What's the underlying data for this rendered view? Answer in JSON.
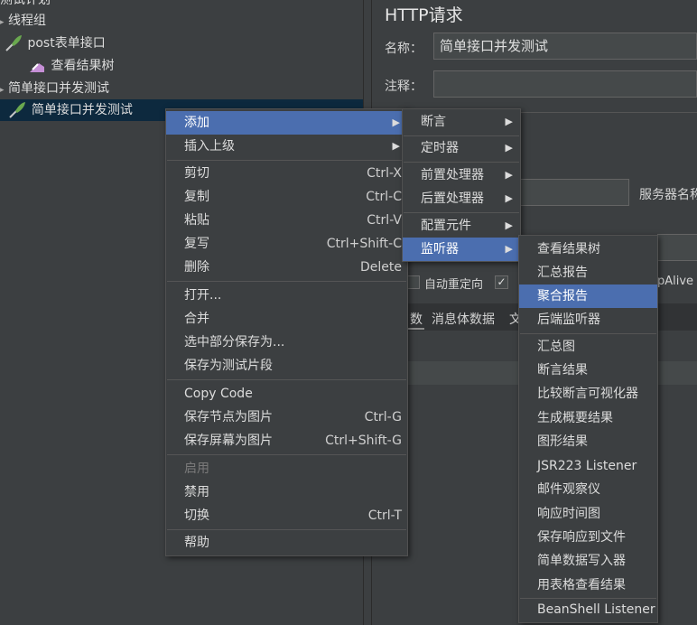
{
  "tree": {
    "items": [
      {
        "label": "测试计划"
      },
      {
        "label": "线程组"
      },
      {
        "label": "post表单接口"
      },
      {
        "label": "查看结果树"
      },
      {
        "label": "简单接口并发测试"
      },
      {
        "label": "简单接口并发测试"
      }
    ]
  },
  "panel": {
    "title": "HTTP请求",
    "name_label": "名称：",
    "name_value": "简单接口并发测试",
    "comment_label": "注释：",
    "server_label": "服务器名称",
    "redirect_label": "自动重定向",
    "keepalive_label": "pAlive",
    "tab_params": "数",
    "tab_body": "消息体数据",
    "tab_files": "文"
  },
  "context_menu": {
    "items": [
      {
        "label": "添加",
        "submenu": true,
        "highlighted": true
      },
      {
        "label": "插入上级",
        "submenu": true
      },
      {
        "label": "剪切",
        "shortcut": "Ctrl-X"
      },
      {
        "label": "复制",
        "shortcut": "Ctrl-C"
      },
      {
        "label": "粘贴",
        "shortcut": "Ctrl-V"
      },
      {
        "label": "复写",
        "shortcut": "Ctrl+Shift-C"
      },
      {
        "label": "删除",
        "shortcut": "Delete"
      },
      {
        "label": "打开..."
      },
      {
        "label": "合并"
      },
      {
        "label": "选中部分保存为..."
      },
      {
        "label": "保存为测试片段"
      },
      {
        "label": "Copy Code"
      },
      {
        "label": "保存节点为图片",
        "shortcut": "Ctrl-G"
      },
      {
        "label": "保存屏幕为图片",
        "shortcut": "Ctrl+Shift-G"
      },
      {
        "label": "启用",
        "disabled": true
      },
      {
        "label": "禁用"
      },
      {
        "label": "切换",
        "shortcut": "Ctrl-T"
      },
      {
        "label": "帮助"
      }
    ]
  },
  "add_submenu": {
    "items": [
      {
        "label": "断言",
        "submenu": true
      },
      {
        "label": "定时器",
        "submenu": true
      },
      {
        "label": "前置处理器",
        "submenu": true
      },
      {
        "label": "后置处理器",
        "submenu": true
      },
      {
        "label": "配置元件",
        "submenu": true
      },
      {
        "label": "监听器",
        "submenu": true,
        "highlighted": true
      }
    ]
  },
  "listener_submenu": {
    "items": [
      {
        "label": "查看结果树"
      },
      {
        "label": "汇总报告"
      },
      {
        "label": "聚合报告",
        "highlighted": true
      },
      {
        "label": "后端监听器"
      },
      {
        "label": "汇总图"
      },
      {
        "label": "断言结果"
      },
      {
        "label": "比较断言可视化器"
      },
      {
        "label": "生成概要结果"
      },
      {
        "label": "图形结果"
      },
      {
        "label": "JSR223 Listener"
      },
      {
        "label": "邮件观察仪"
      },
      {
        "label": "响应时间图"
      },
      {
        "label": "保存响应到文件"
      },
      {
        "label": "简单数据写入器"
      },
      {
        "label": "用表格查看结果"
      },
      {
        "label": "BeanShell Listener"
      }
    ]
  },
  "colors": {
    "background": "#3c3f41",
    "highlight": "#4b6eaf",
    "selection": "#0d293e"
  }
}
